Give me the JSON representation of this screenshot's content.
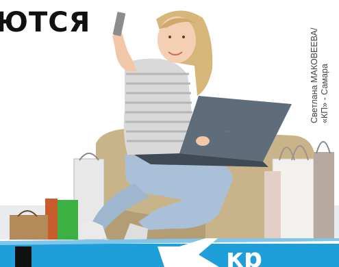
{
  "headline": {
    "text": "ЮТСЯ"
  },
  "photo_credit": {
    "line1": "Светлана МАКОВЕЕВА/",
    "line2": "«КП» - Самара"
  },
  "banner": {
    "text": "кр",
    "accent_color": "#1e9fd9"
  },
  "colors": {
    "background": "#ffffff",
    "text": "#111111",
    "sofa": "#c9b48a",
    "jeans": "#a9c0d8",
    "laptop": "#5f6c79"
  }
}
